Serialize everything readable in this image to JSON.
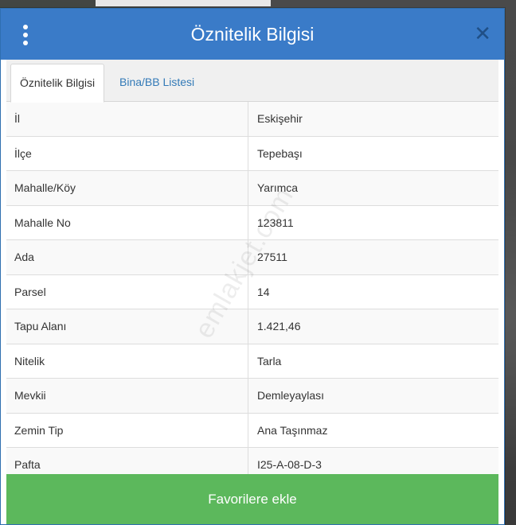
{
  "dialog": {
    "title": "Öznitelik Bilgisi",
    "close_symbol": "✕"
  },
  "tabs": [
    {
      "label": "Öznitelik Bilgisi",
      "active": true
    },
    {
      "label": "Bina/BB Listesi",
      "active": false
    }
  ],
  "rows": [
    {
      "label": "İl",
      "value": "Eskişehir"
    },
    {
      "label": "İlçe",
      "value": "Tepebaşı"
    },
    {
      "label": "Mahalle/Köy",
      "value": "Yarımca"
    },
    {
      "label": "Mahalle No",
      "value": "123811"
    },
    {
      "label": "Ada",
      "value": "27511"
    },
    {
      "label": "Parsel",
      "value": "14"
    },
    {
      "label": "Tapu Alanı",
      "value": "1.421,46"
    },
    {
      "label": "Nitelik",
      "value": "Tarla"
    },
    {
      "label": "Mevkii",
      "value": "Demleyaylası"
    },
    {
      "label": "Zemin Tip",
      "value": "Ana Taşınmaz"
    },
    {
      "label": "Pafta",
      "value": "I25-A-08-D-3"
    }
  ],
  "favorite_button": {
    "label": "Favorilere ekle"
  },
  "watermark": "emlakjet.com",
  "icons": {
    "menu": "kebab-menu-icon",
    "close": "close-icon"
  },
  "colors": {
    "header": "#3a7bc8",
    "button": "#5cb85c",
    "link": "#337ab7"
  }
}
